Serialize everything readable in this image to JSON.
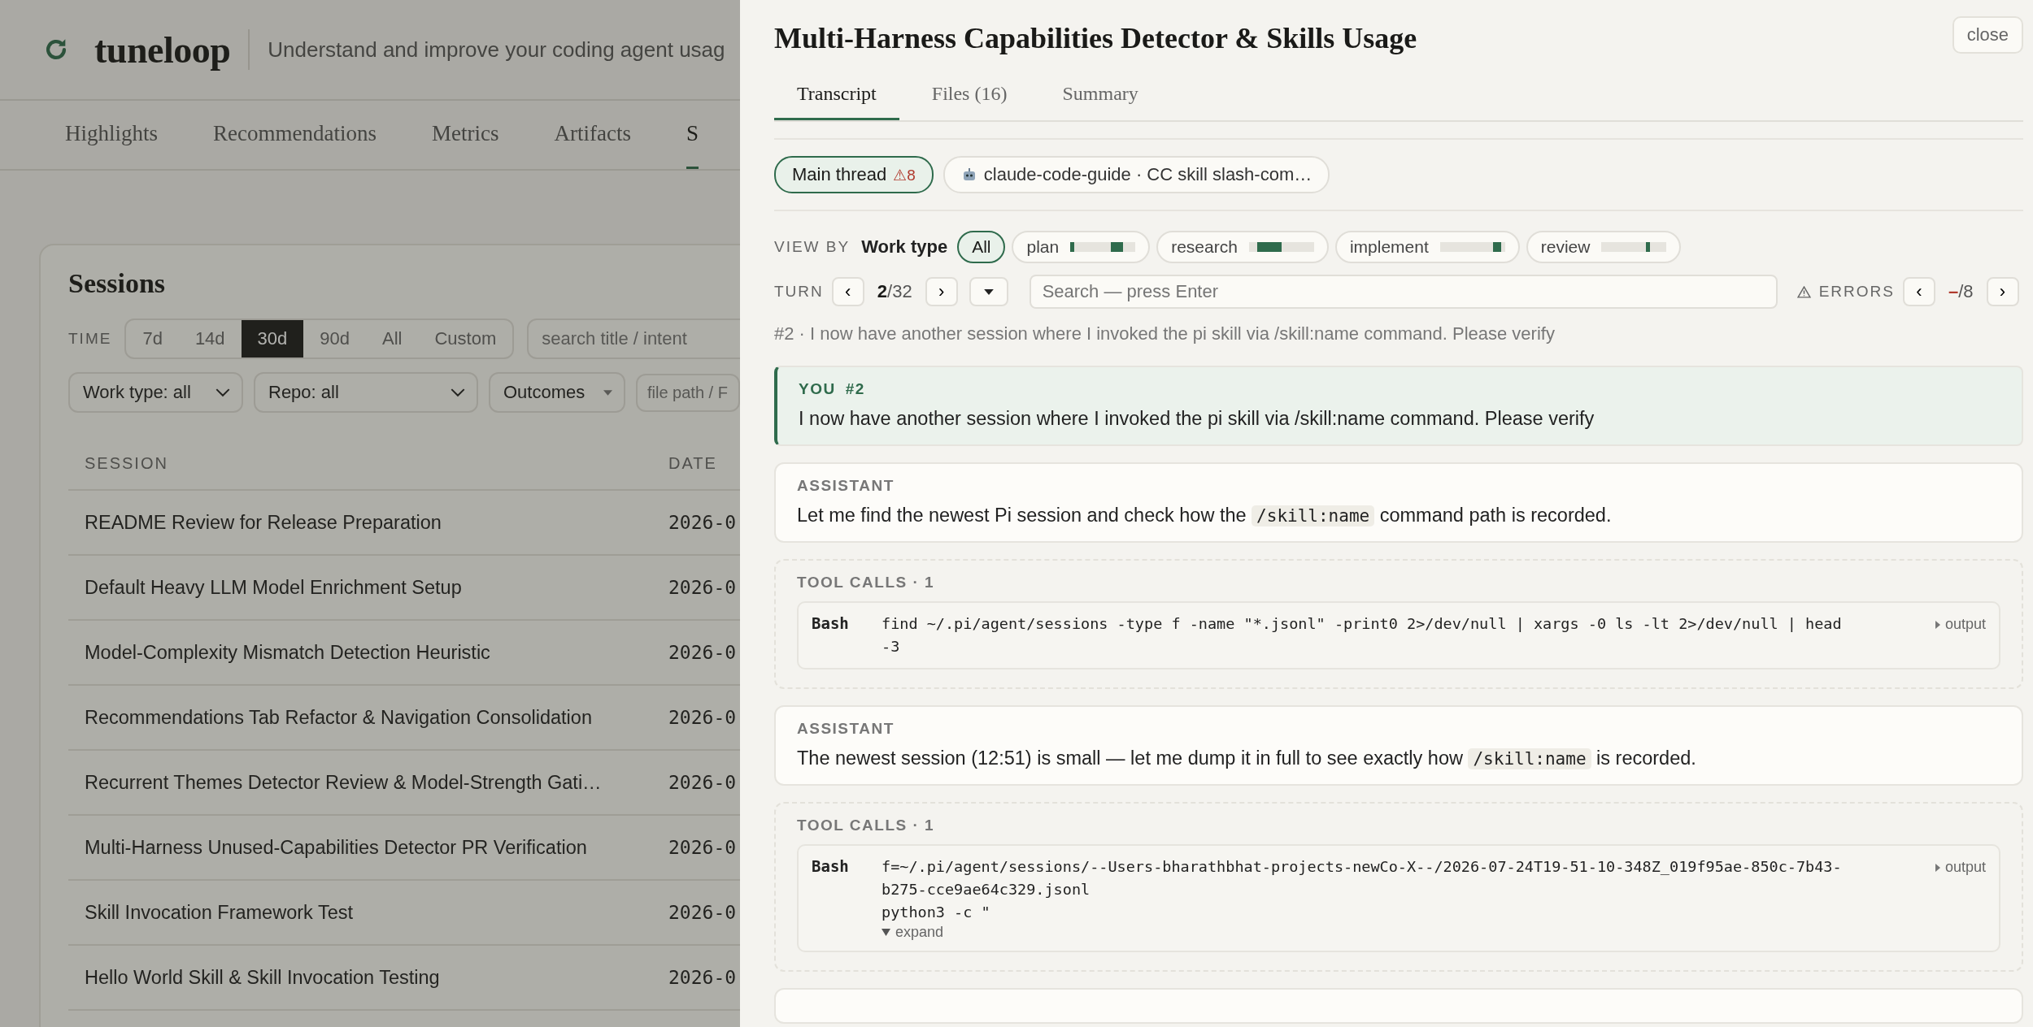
{
  "app": {
    "brand": "tuneloop",
    "tagline": "Understand and improve your coding agent usag"
  },
  "nav": [
    {
      "label": "Highlights",
      "selected": false
    },
    {
      "label": "Recommendations",
      "selected": false
    },
    {
      "label": "Metrics",
      "selected": false
    },
    {
      "label": "Artifacts",
      "selected": false
    },
    {
      "label": "S",
      "selected": true
    }
  ],
  "sessions": {
    "title": "Sessions",
    "time_label": "TIME",
    "time_ranges": [
      {
        "label": "7d",
        "selected": false
      },
      {
        "label": "14d",
        "selected": false
      },
      {
        "label": "30d",
        "selected": true
      },
      {
        "label": "90d",
        "selected": false
      },
      {
        "label": "All",
        "selected": false
      },
      {
        "label": "Custom",
        "selected": false
      }
    ],
    "search": {
      "placeholder": "search title / intent"
    },
    "filters": [
      {
        "label": "Work type: all",
        "kind": "select"
      },
      {
        "label": "Repo: all",
        "kind": "select"
      },
      {
        "label": "Outcomes",
        "kind": "menu"
      }
    ],
    "file_search": {
      "placeholder": "file path / F"
    },
    "columns": [
      "SESSION",
      "DATE"
    ],
    "rows": [
      {
        "title": "README Review for Release Preparation",
        "date": "2026-0"
      },
      {
        "title": "Default Heavy LLM Model Enrichment Setup",
        "date": "2026-0"
      },
      {
        "title": "Model-Complexity Mismatch Detection Heuristic",
        "date": "2026-0"
      },
      {
        "title": "Recommendations Tab Refactor & Navigation Consolidation",
        "date": "2026-0"
      },
      {
        "title": "Recurrent Themes Detector Review & Model-Strength Gati…",
        "date": "2026-0"
      },
      {
        "title": "Multi-Harness Unused-Capabilities Detector PR Verification",
        "date": "2026-0"
      },
      {
        "title": "Skill Invocation Framework Test",
        "date": "2026-0"
      },
      {
        "title": "Hello World Skill & Skill Invocation Testing",
        "date": "2026-0"
      }
    ]
  },
  "drawer": {
    "title": "Multi-Harness Capabilities Detector & Skills Usage",
    "close": "close",
    "tabs": [
      {
        "label": "Transcript",
        "selected": true
      },
      {
        "label": "Files (16)",
        "selected": false
      },
      {
        "label": "Summary",
        "selected": false
      }
    ],
    "threads": [
      {
        "label": "Main thread",
        "warning": "⚠8",
        "kind": "main",
        "selected": true
      },
      {
        "label": "claude-code-guide · CC skill slash-com…",
        "kind": "agent",
        "selected": false
      }
    ],
    "view_by": {
      "label": "VIEW BY",
      "mode": "Work type",
      "chips": [
        {
          "label": "All",
          "kind": "all",
          "selected": true
        },
        {
          "label": "plan",
          "kind": "strip",
          "selected": false
        },
        {
          "label": "research",
          "kind": "strip",
          "selected": false
        },
        {
          "label": "implement",
          "kind": "strip",
          "selected": false
        },
        {
          "label": "review",
          "kind": "strip",
          "selected": false
        }
      ]
    },
    "turn": {
      "label": "TURN",
      "prev": "‹",
      "current": "2",
      "total": "/32",
      "next": "›",
      "search_placeholder": "Search — press Enter",
      "errors_label": "ERRORS",
      "errors_prev": "‹",
      "errors_current": "–",
      "errors_total": "/8",
      "errors_next": "›"
    },
    "turn_summary": "#2 · I now have another session where I invoked the pi skill via /skill:name command. Please verify",
    "messages": [
      {
        "kind": "user",
        "role": "YOU",
        "number": "#2",
        "parts": [
          {
            "kind": "text",
            "text": "I now have another session where I invoked the pi skill via /skill:name command. Please verify"
          }
        ]
      },
      {
        "kind": "assistant",
        "role": "ASSISTANT",
        "parts": [
          {
            "kind": "text",
            "text": "Let me find the newest Pi session and check how the "
          },
          {
            "kind": "code",
            "text": "/skill:name"
          },
          {
            "kind": "text",
            "text": " command path is recorded."
          }
        ]
      },
      {
        "kind": "tools",
        "heading": "TOOL CALLS · 1",
        "calls": [
          {
            "tool": "Bash",
            "lines": [
              "find ~/.pi/agent/sessions -type f -name \"*.jsonl\" -print0 2>/dev/null | xargs -0 ls -lt 2>/dev/null | head",
              "-3"
            ],
            "output": "output"
          }
        ]
      },
      {
        "kind": "assistant",
        "role": "ASSISTANT",
        "parts": [
          {
            "kind": "text",
            "text": "The newest session (12:51) is small — let me dump it in full to see exactly how "
          },
          {
            "kind": "code",
            "text": "/skill:name"
          },
          {
            "kind": "text",
            "text": " is recorded."
          }
        ]
      },
      {
        "kind": "tools",
        "heading": "TOOL CALLS · 1",
        "calls": [
          {
            "tool": "Bash",
            "lines": [
              "f=~/.pi/agent/sessions/--Users-bharathbhat-projects-newCo-X--/2026-07-24T19-51-10-348Z_019f95ae-850c-7b43-",
              "b275-cce9ae64c329.jsonl",
              "python3 -c \""
            ],
            "output": "output",
            "expand": "expand"
          }
        ]
      }
    ]
  }
}
